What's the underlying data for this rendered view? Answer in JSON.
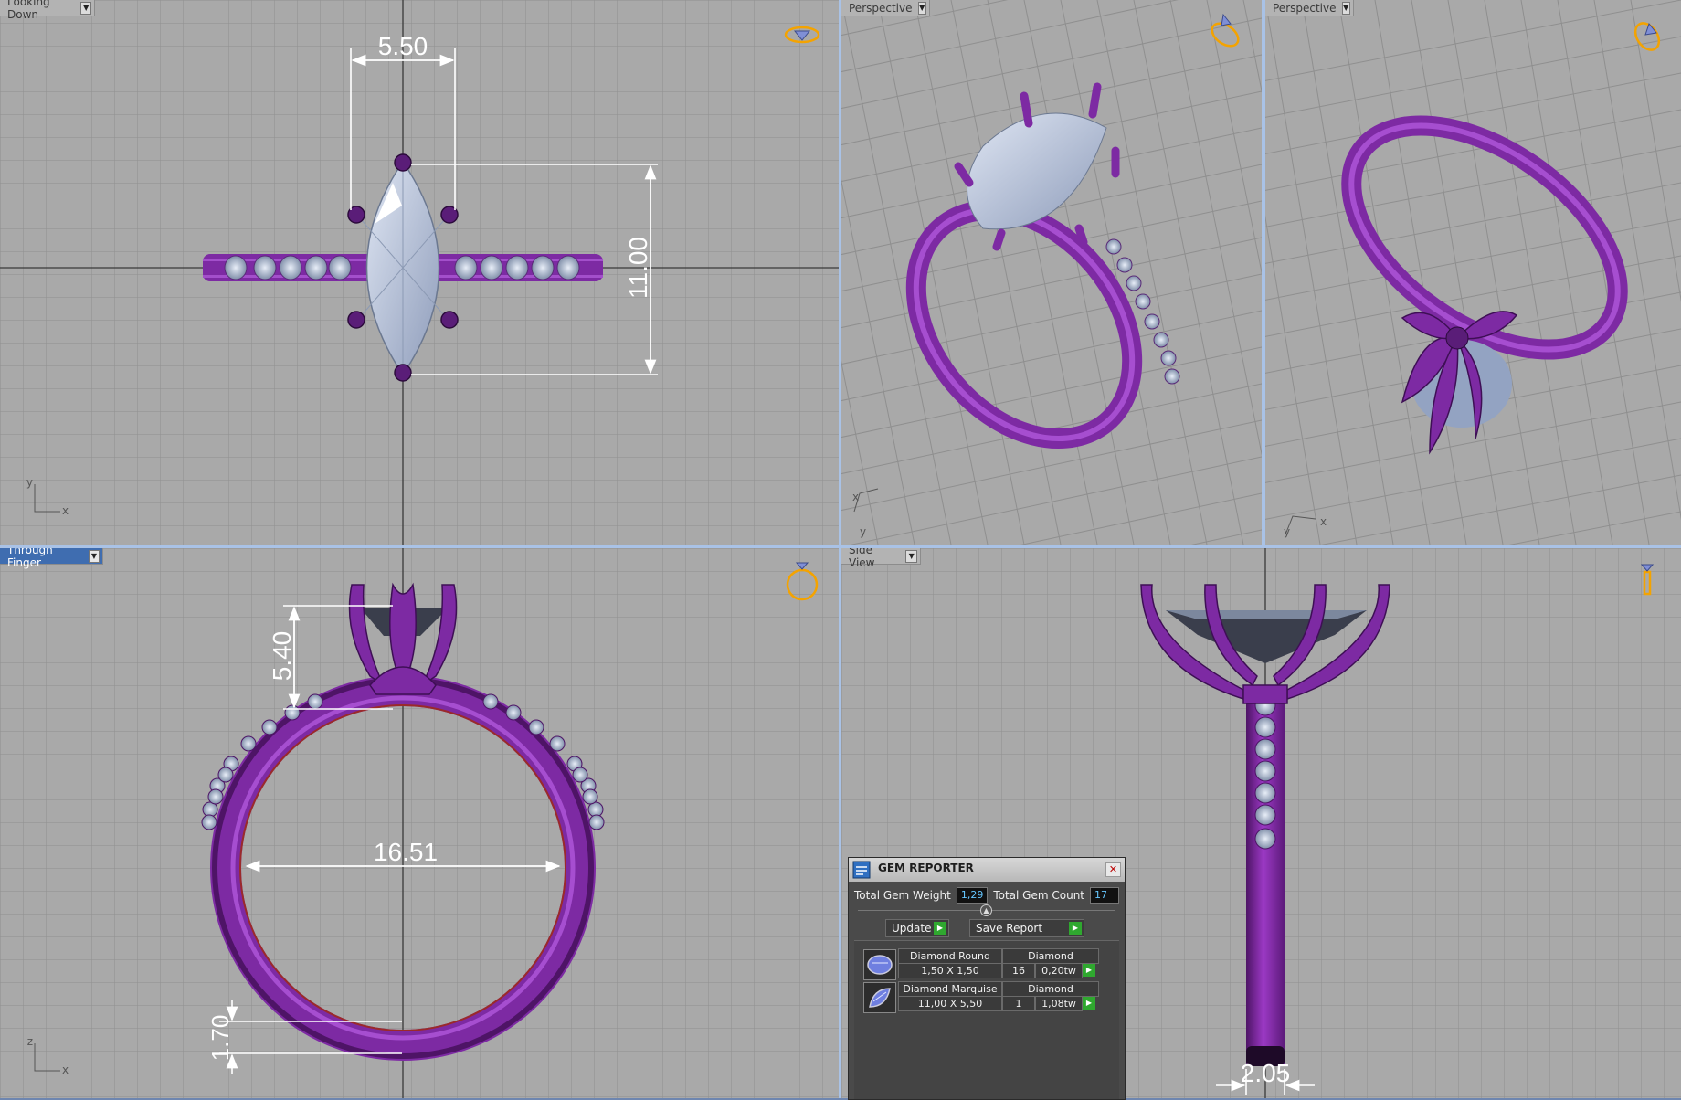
{
  "viewports": {
    "top_left": {
      "label": "Looking Down",
      "active": false
    },
    "top_mid": {
      "label": "Perspective",
      "active": false
    },
    "top_right": {
      "label": "Perspective",
      "active": false
    },
    "bottom_left": {
      "label": "Through Finger",
      "active": true
    },
    "bottom_right": {
      "label": "Side View",
      "active": false
    }
  },
  "dimensions": {
    "top_width": "5.50",
    "top_length": "11.00",
    "finger_head_height": "5.40",
    "finger_inner_diameter": "16.51",
    "finger_shank_thickness": "1.70",
    "side_shank_width": "2.05"
  },
  "axes": {
    "x": "x",
    "y": "y",
    "z": "z"
  },
  "gem_reporter": {
    "title": "GEM REPORTER",
    "total_weight_label": "Total Gem Weight",
    "total_weight_value": "1,29",
    "total_count_label": "Total Gem Count",
    "total_count_value": "17",
    "update_label": "Update",
    "save_report_label": "Save Report",
    "gems": [
      {
        "name": "Diamond Round",
        "material": "Diamond",
        "size": "1,50 X 1,50",
        "count": "16",
        "weight": "0,20tw"
      },
      {
        "name": "Diamond Marquise",
        "material": "Diamond",
        "size": "11,00 X 5,50",
        "count": "1",
        "weight": "1,08tw"
      }
    ]
  },
  "colors": {
    "metal": "#8a2fb0",
    "metal_dark": "#4e1466",
    "gem": "#a9b8d4",
    "grid_bg": "#a9a9a9",
    "active_tab": "#3f6db0"
  }
}
